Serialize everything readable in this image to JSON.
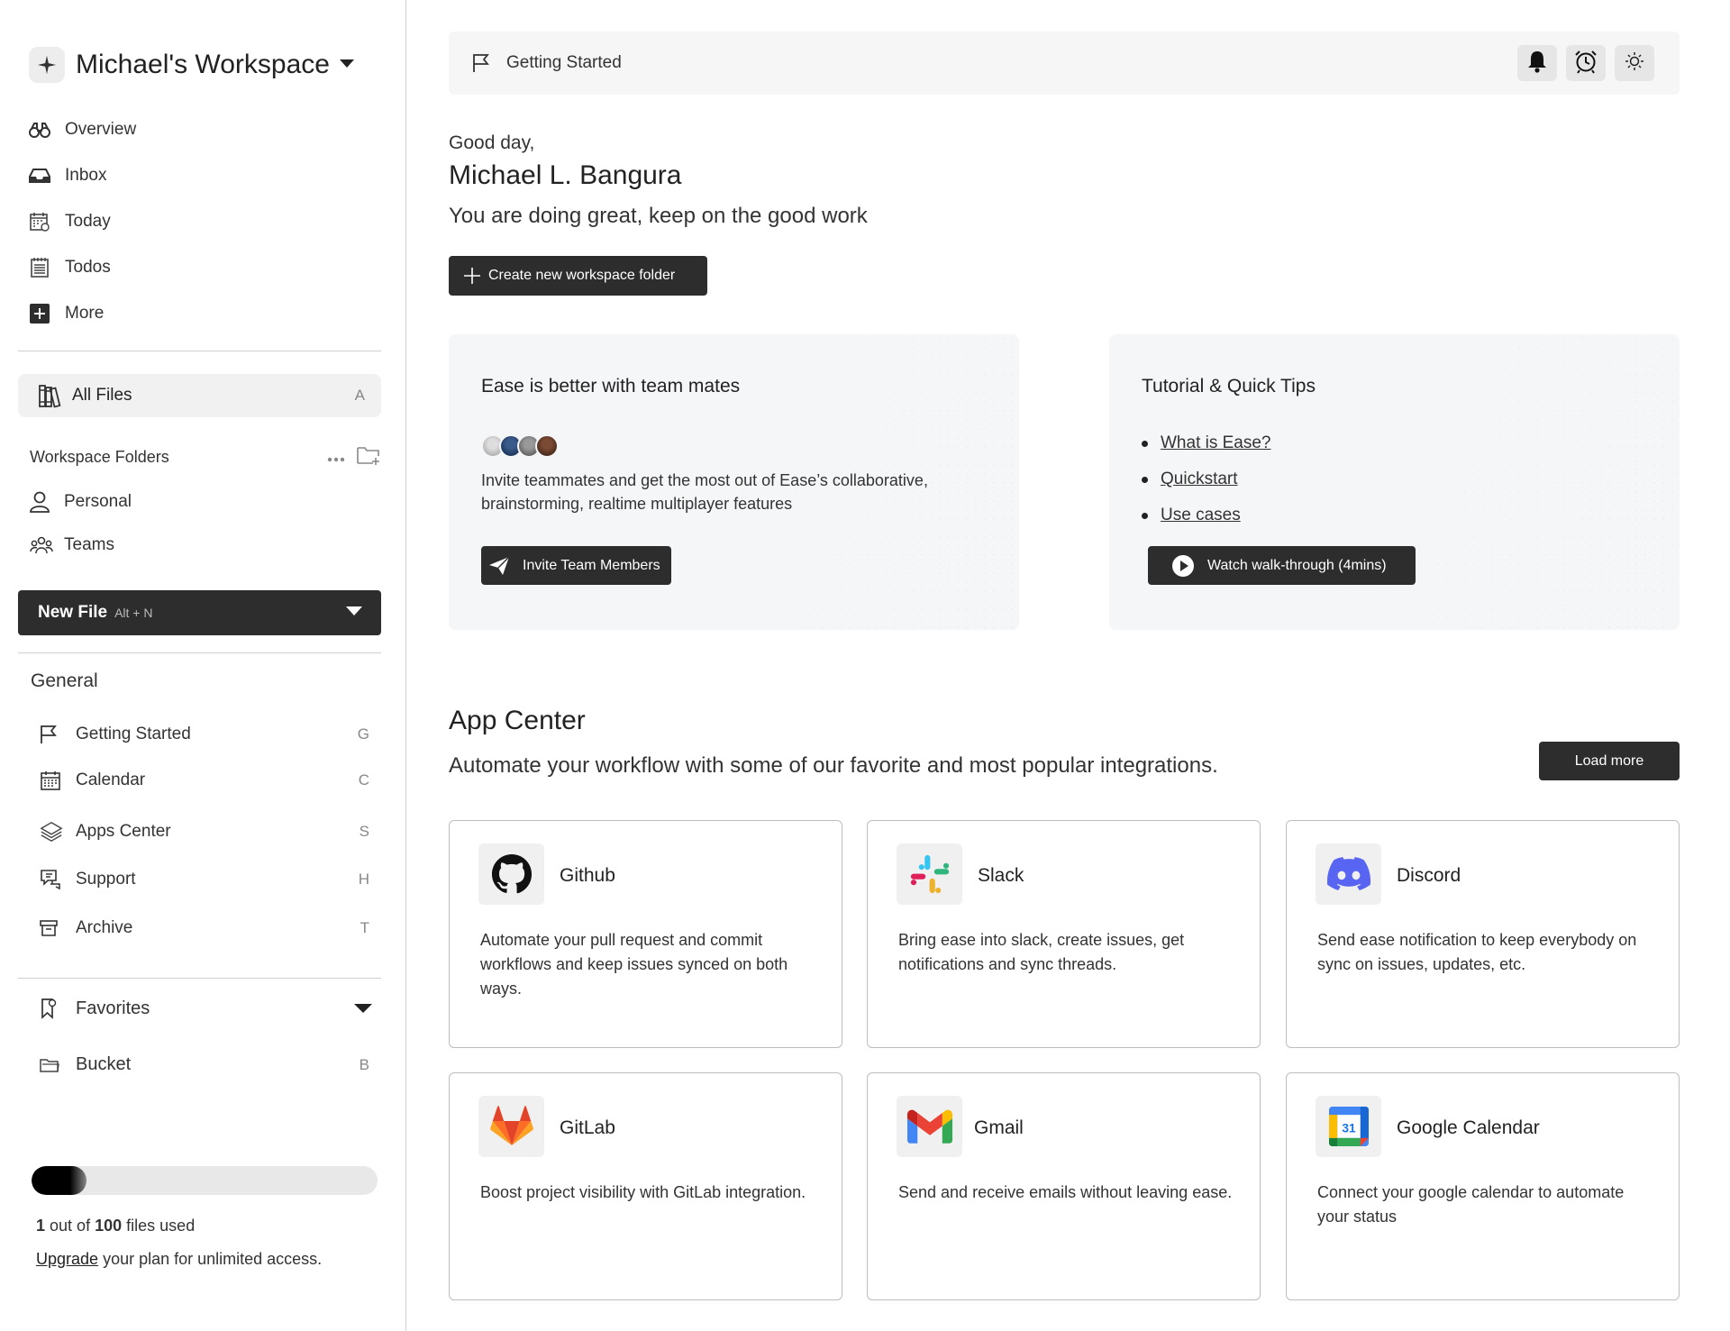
{
  "sidebar": {
    "workspace_title": "Michael's Workspace",
    "nav": [
      {
        "label": "Overview",
        "icon": "binoculars-icon"
      },
      {
        "label": "Inbox",
        "icon": "inbox-icon"
      },
      {
        "label": "Today",
        "icon": "calendar-today-icon"
      },
      {
        "label": "Todos",
        "icon": "checklist-icon"
      },
      {
        "label": "More",
        "icon": "plus-square-icon"
      }
    ],
    "all_files": {
      "label": "All Files",
      "shortcut": "A"
    },
    "workspace_folders": {
      "title": "Workspace Folders",
      "items": [
        {
          "label": "Personal",
          "icon": "person-icon"
        },
        {
          "label": "Teams",
          "icon": "team-icon"
        }
      ]
    },
    "new_file": {
      "label": "New File",
      "shortcut": "Alt + N"
    },
    "general": {
      "title": "General",
      "items": [
        {
          "label": "Getting Started",
          "shortcut": "G",
          "icon": "flag-icon"
        },
        {
          "label": "Calendar",
          "shortcut": "C",
          "icon": "calendar-icon"
        },
        {
          "label": "Apps Center",
          "shortcut": "S",
          "icon": "layers-icon"
        },
        {
          "label": "Support",
          "shortcut": "H",
          "icon": "support-chat-icon"
        },
        {
          "label": "Archive",
          "shortcut": "T",
          "icon": "archive-icon"
        }
      ]
    },
    "favorites": {
      "label": "Favorites"
    },
    "bucket": {
      "label": "Bucket",
      "shortcut": "B"
    },
    "usage": {
      "used": "1",
      "total": "100",
      "used_fraction": 0.01,
      "text_out_of": "out of",
      "text_files_used": "files used",
      "upgrade_link": "Upgrade",
      "upgrade_rest": "your plan for unlimited access."
    }
  },
  "topbar": {
    "breadcrumb": "Getting Started",
    "tools": [
      "bell-icon",
      "alarm-clock-icon",
      "sun-icon"
    ]
  },
  "main": {
    "greeting": "Good day,",
    "user_name": "Michael L. Bangura",
    "motto": "You are doing great, keep on the good work",
    "create_button": "Create new workspace folder"
  },
  "team_card": {
    "title": "Ease is better with team mates",
    "description": "Invite teammates and get the most out of Ease’s collaborative, brainstorming, realtime multiplayer features",
    "button": "Invite Team Members"
  },
  "tips_card": {
    "title": "Tutorial & Quick Tips",
    "links": [
      "What is Ease?",
      "Quickstart",
      "Use cases"
    ],
    "button": "Watch walk-through (4mins)"
  },
  "app_center": {
    "title": "App Center",
    "subtitle": "Automate your workflow with some of our favorite and most popular integrations.",
    "load_more": "Load more",
    "apps": [
      {
        "name": "Github",
        "icon": "github-icon",
        "description": "Automate your pull request and commit workflows and keep issues synced on both ways."
      },
      {
        "name": "Slack",
        "icon": "slack-icon",
        "description": "Bring ease into slack, create issues, get notifications and sync threads."
      },
      {
        "name": "Discord",
        "icon": "discord-icon",
        "description": "Send ease notification to keep everybody on sync on issues, updates, etc."
      },
      {
        "name": "GitLab",
        "icon": "gitlab-icon",
        "description": "Boost project visibility with GitLab integration."
      },
      {
        "name": "Gmail",
        "icon": "gmail-icon",
        "description": "Send and receive emails without leaving ease."
      },
      {
        "name": "Google Calendar",
        "icon": "google-calendar-icon",
        "description": "Connect your google calendar to automate your status"
      }
    ]
  },
  "colors": {
    "dark_button": "#2d2d2d",
    "panel_bg": "#f6f6f6",
    "discord": "#5865F2",
    "gitlab": "#E24329"
  }
}
